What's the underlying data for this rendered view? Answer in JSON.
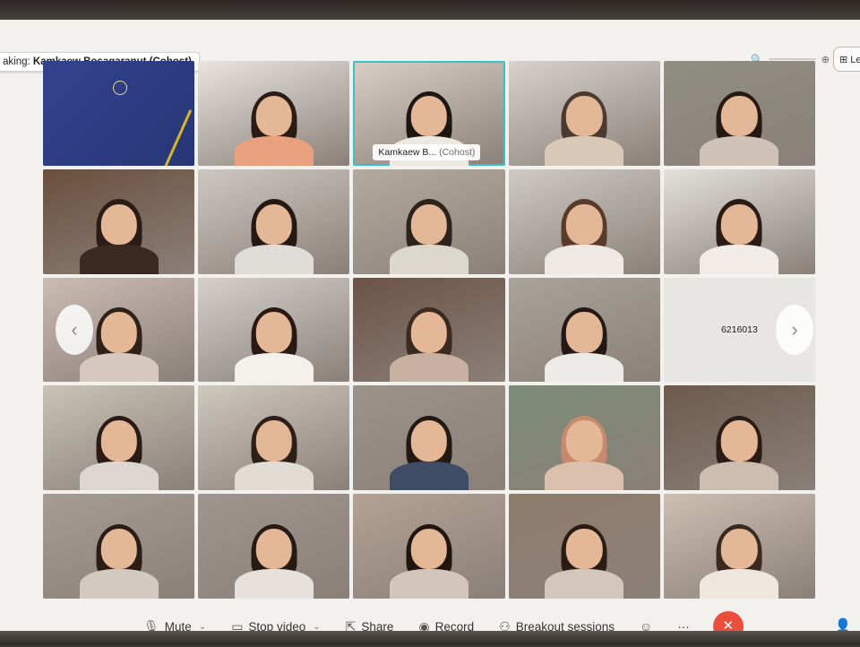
{
  "speaking": {
    "prefix": "aking:",
    "name": "Kamkaew Bosagaranut (Cohost)"
  },
  "layout_button": {
    "label": "Le"
  },
  "tiles": [
    {
      "type": "card",
      "bg": "#2e3e87"
    },
    {
      "type": "video",
      "bg": "#e9e4df",
      "shirt": "#e9a07f",
      "hair": "#2a1b14"
    },
    {
      "type": "video",
      "bg": "#d8d0c6",
      "shirt": "#ece8e2",
      "hair": "#1e1612",
      "active": true,
      "name": "Kamkaew B...",
      "cohost": "(Cohost)"
    },
    {
      "type": "video",
      "bg": "#d7d2cd",
      "shirt": "#d8c8b5",
      "hair": "#4a3a2f"
    },
    {
      "type": "video",
      "bg": "#8f8f82",
      "shirt": "#cfc3b8",
      "hair": "#261912"
    },
    {
      "type": "video",
      "bg": "#6b4f3c",
      "shirt": "#3a2a22",
      "hair": "#2b1c15"
    },
    {
      "type": "video",
      "bg": "#cec7c1",
      "shirt": "#e0ddd9",
      "hair": "#241812"
    },
    {
      "type": "video",
      "bg": "#b4ab9f",
      "shirt": "#dcd7cf",
      "hair": "#2d231d"
    },
    {
      "type": "video",
      "bg": "#cfcac4",
      "shirt": "#efe9e3",
      "hair": "#5a3b2a"
    },
    {
      "type": "video",
      "bg": "#e3e1dd",
      "shirt": "#f1ece7",
      "hair": "#2a1b14"
    },
    {
      "type": "video",
      "bg": "#cbbcb3",
      "shirt": "#d7c8bf",
      "hair": "#2f2019"
    },
    {
      "type": "video",
      "bg": "#d4d0cc",
      "shirt": "#f4f1ec",
      "hair": "#2a1912"
    },
    {
      "type": "video",
      "bg": "#6c5346",
      "shirt": "#c8b1a0",
      "hair": "#3a2a20"
    },
    {
      "type": "video",
      "bg": "#a9a399",
      "shirt": "#ecebe8",
      "hair": "#231813"
    },
    {
      "type": "text",
      "bg": "#e8e6e3",
      "label": "6216013"
    },
    {
      "type": "video",
      "bg": "#c9c3b5",
      "shirt": "#dcd5d0",
      "hair": "#2a1b14"
    },
    {
      "type": "video",
      "bg": "#cfc8bd",
      "shirt": "#e2dcd5",
      "hair": "#2d1f17"
    },
    {
      "type": "video",
      "bg": "#9b938b",
      "shirt": "#3f4c66",
      "hair": "#231913"
    },
    {
      "type": "video",
      "bg": "#7d8c76",
      "shirt": "#dcc0ae",
      "hair": "#c88a6e"
    },
    {
      "type": "video",
      "bg": "#6d5a4c",
      "shirt": "#cdbcb0",
      "hair": "#2a1c15"
    },
    {
      "type": "video",
      "bg": "#a59c94",
      "shirt": "#d4c9c0",
      "hair": "#2b1d16"
    },
    {
      "type": "video",
      "bg": "#a0958e",
      "shirt": "#e6e1db",
      "hair": "#261a14"
    },
    {
      "type": "video",
      "bg": "#b3a293",
      "shirt": "#d2c6bc",
      "hair": "#21160f"
    },
    {
      "type": "video",
      "bg": "#8f7c6b",
      "shirt": "#d3c6bb",
      "hair": "#2a1b14"
    },
    {
      "type": "video",
      "bg": "#cdbfb1",
      "shirt": "#ede7df",
      "hair": "#3a2920"
    }
  ],
  "toolbar": {
    "mute_label": "Mute",
    "stop_video_label": "Stop video",
    "share_label": "Share",
    "record_label": "Record",
    "breakout_label": "Breakout sessions",
    "more_label": "···"
  },
  "colors": {
    "active_speaker_border": "#38c1c9",
    "leave_button": "#ec4e3c"
  }
}
